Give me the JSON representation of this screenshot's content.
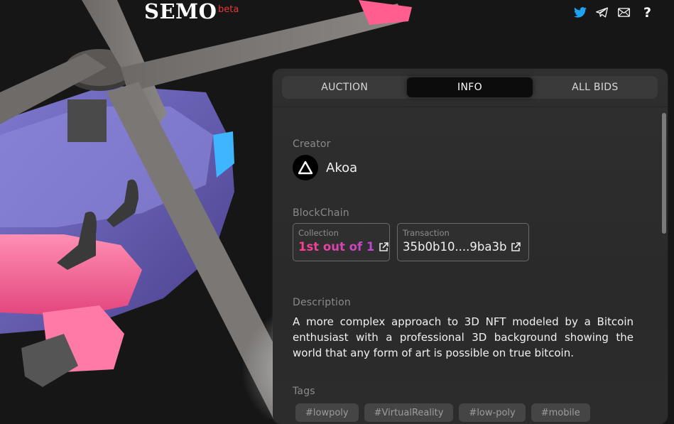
{
  "header": {
    "logo": "SEMO",
    "beta": "beta",
    "icons": [
      "twitter-icon",
      "telegram-icon",
      "mail-icon",
      "help-icon"
    ],
    "help_glyph": "?"
  },
  "tabs": [
    {
      "label": "AUCTION",
      "active": false
    },
    {
      "label": "INFO",
      "active": true
    },
    {
      "label": "ALL BIDS",
      "active": false
    }
  ],
  "info": {
    "creator_label": "Creator",
    "creator_name": "Akoa",
    "blockchain_label": "BlockChain",
    "collection": {
      "label": "Collection",
      "value": "1st out of 1"
    },
    "transaction": {
      "label": "Transaction",
      "value": "35b0b10....9ba3b"
    },
    "description_label": "Description",
    "description": "A more complex approach to 3D NFT modeled by a Bitcoin enthusiast with a professional 3D background showing the world that any form of art is possible on true bitcoin.",
    "tags_label": "Tags",
    "tags": [
      "#lowpoly",
      "#VirtualReality",
      "#low-poly",
      "#mobile"
    ]
  },
  "colors": {
    "accent_pink": "#ff3e8d",
    "accent_purple": "#b04ad8",
    "beta_red": "#e53935",
    "twitter_blue": "#1da1f2",
    "background": "#161616",
    "panel": "#2f2f2f"
  }
}
